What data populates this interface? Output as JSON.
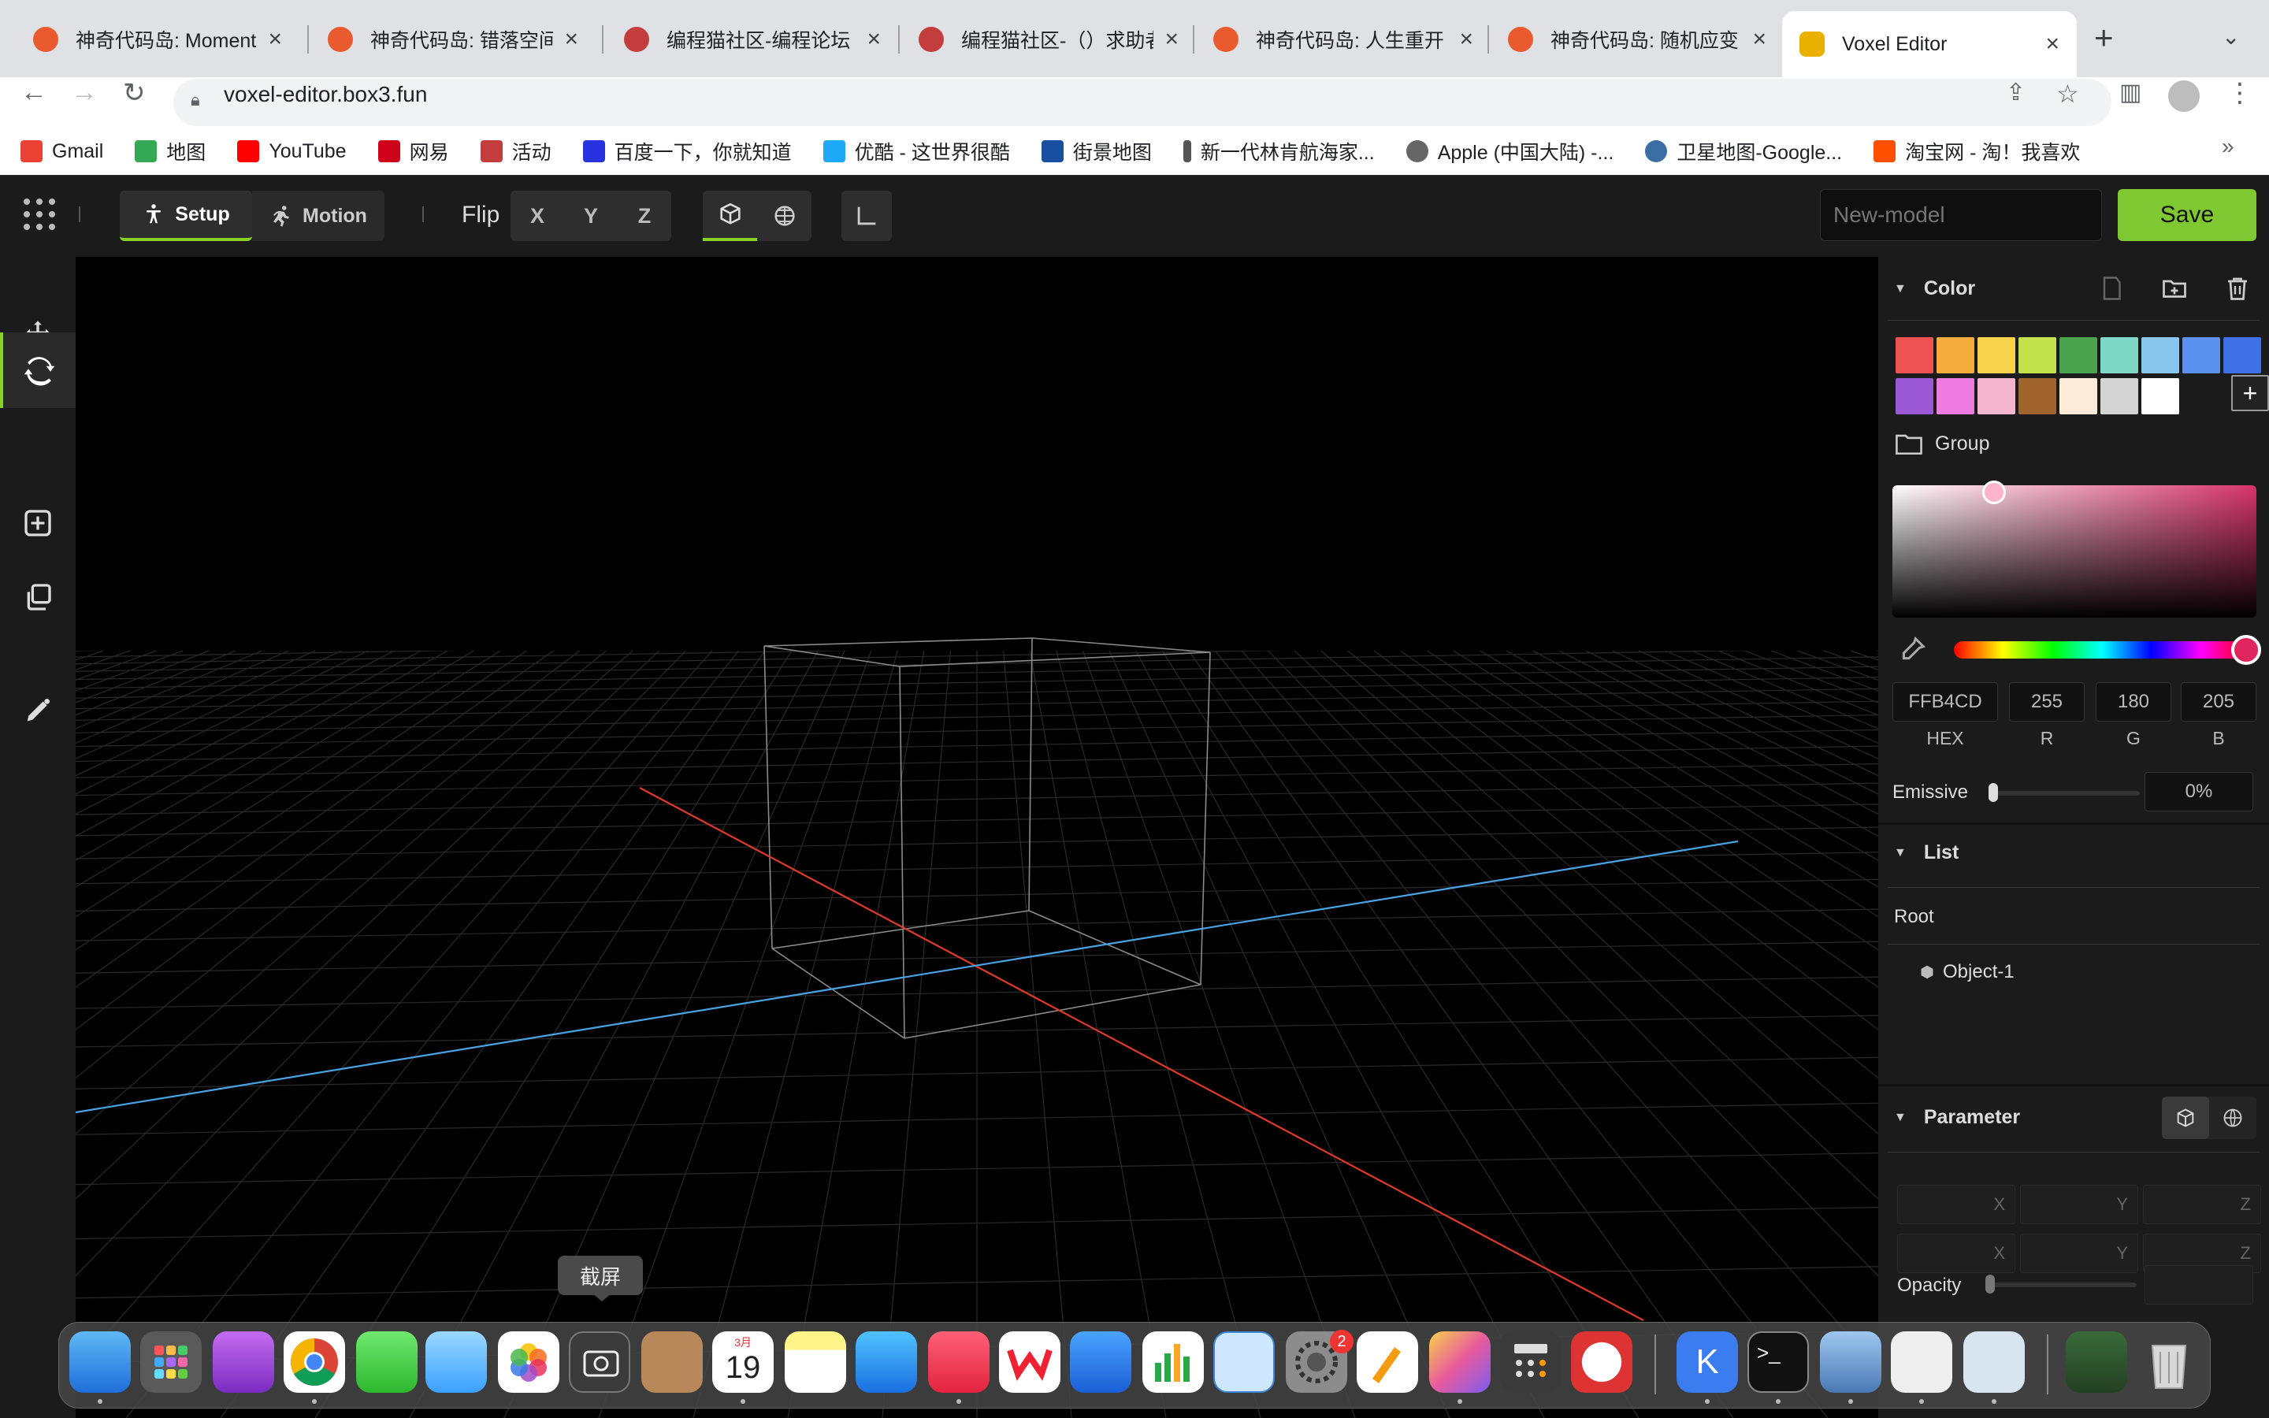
{
  "browser": {
    "tabs": [
      {
        "title": "神奇代码岛: Moment",
        "color": "#ea5a2f"
      },
      {
        "title": "神奇代码岛: 错落空间",
        "color": "#ea5a2f"
      },
      {
        "title": "编程猫社区-编程论坛",
        "color": "#c43d3d"
      },
      {
        "title": "编程猫社区-（）求助者",
        "color": "#c43d3d"
      },
      {
        "title": "神奇代码岛: 人生重开",
        "color": "#ea5a2f"
      },
      {
        "title": "神奇代码岛: 随机应变",
        "color": "#ea5a2f"
      },
      {
        "title": "Voxel Editor",
        "color": "#e8b100"
      }
    ],
    "url": "voxel-editor.box3.fun",
    "bookmarks": [
      {
        "label": "Gmail",
        "color": "#ea4335"
      },
      {
        "label": "地图",
        "color": "#34a853"
      },
      {
        "label": "YouTube",
        "color": "#ff0000"
      },
      {
        "label": "网易",
        "color": "#d0021b"
      },
      {
        "label": "活动",
        "color": "#c43d3d"
      },
      {
        "label": "百度一下，你就知道",
        "color": "#2932e1"
      },
      {
        "label": "优酷 - 这世界很酷",
        "color": "#1ea8f5"
      },
      {
        "label": "街景地图",
        "color": "#1a4fa0"
      },
      {
        "label": "新一代林肯航海家...",
        "color": "#555555"
      },
      {
        "label": "Apple (中国大陆) -...",
        "color": "#666666"
      },
      {
        "label": "卫星地图-Google...",
        "color": "#3b6ea5"
      },
      {
        "label": "淘宝网 - 淘！我喜欢",
        "color": "#ff5000"
      }
    ]
  },
  "toolbar": {
    "setup_label": "Setup",
    "motion_label": "Motion",
    "flip_label": "Flip",
    "flip_axes": [
      "X",
      "Y",
      "Z"
    ],
    "model_name_placeholder": "New-model",
    "save_label": "Save",
    "accent": "#8ad127"
  },
  "color_panel": {
    "title": "Color",
    "swatches": [
      "#ee5252",
      "#f4ad3c",
      "#f8d24a",
      "#c4e24a",
      "#4aa44f",
      "#7fd8c6",
      "#8ac6ee",
      "#5b92f0",
      "#3f70e8",
      "#9b59d6",
      "#ee7be2",
      "#f4b6cd",
      "#a2642e",
      "#fcebd9",
      "#d4d4d4",
      "#ffffff"
    ],
    "group_label": "Group",
    "hex": "FFB4CD",
    "r": "255",
    "g": "180",
    "b": "205",
    "hex_label": "HEX",
    "r_label": "R",
    "g_label": "G",
    "b_label": "B",
    "emissive_label": "Emissive",
    "emissive_value": "0%",
    "current_color": "#ffb4cd"
  },
  "list_panel": {
    "title": "List",
    "root_label": "Root",
    "objects": [
      "Object-1"
    ]
  },
  "parameter_panel": {
    "title": "Parameter",
    "row1": [
      "X",
      "Y",
      "Z"
    ],
    "row2": [
      "X",
      "Y",
      "Z"
    ],
    "opacity_label": "Opacity"
  },
  "tooltip": "截屏",
  "dock": {
    "calendar_month": "3月",
    "calendar_day": "19",
    "badge_count": "2"
  }
}
